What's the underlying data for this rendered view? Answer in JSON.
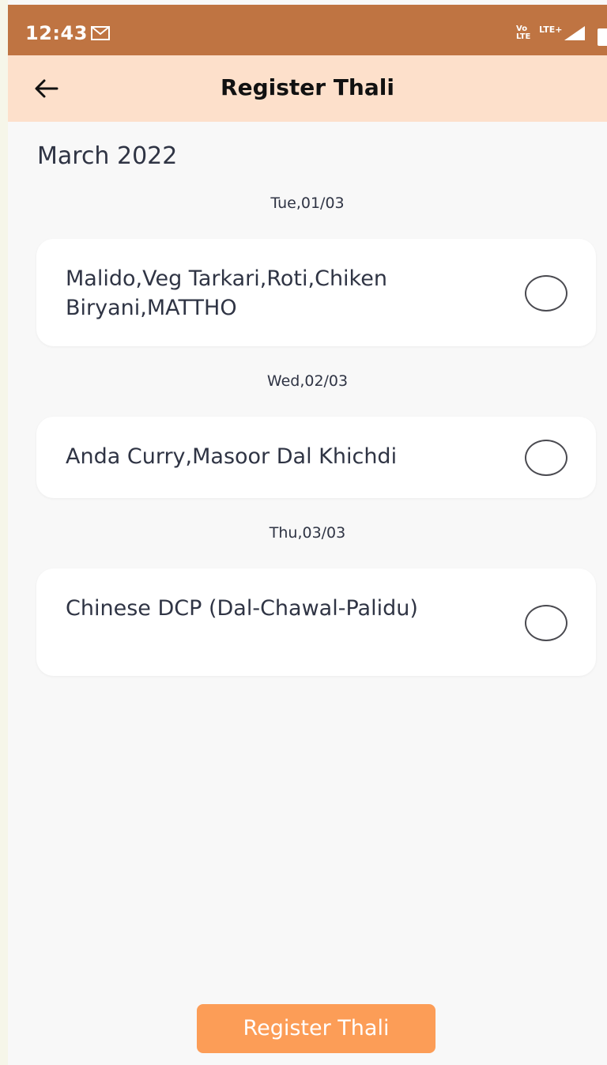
{
  "status_bar": {
    "time": "12:43",
    "volte_line1": "Vo",
    "volte_line2": "LTE",
    "network": "LTE+"
  },
  "app_bar": {
    "title": "Register Thali"
  },
  "month_label": "March 2022",
  "days": [
    {
      "date": "Tue,01/03",
      "menu": "Malido,Veg Tarkari,Roti,Chiken Biryani,MATTHO",
      "selected": false
    },
    {
      "date": "Wed,02/03",
      "menu": "Anda Curry,Masoor Dal Khichdi",
      "selected": false
    },
    {
      "date": "Thu,03/03",
      "menu": "Chinese DCP (Dal-Chawal-Palidu)",
      "selected": false
    }
  ],
  "register_button_label": "Register Thali",
  "colors": {
    "status_bar": "#bf7442",
    "app_bar": "#fde0cb",
    "button": "#fc9d57",
    "background": "#f8f8f8"
  }
}
